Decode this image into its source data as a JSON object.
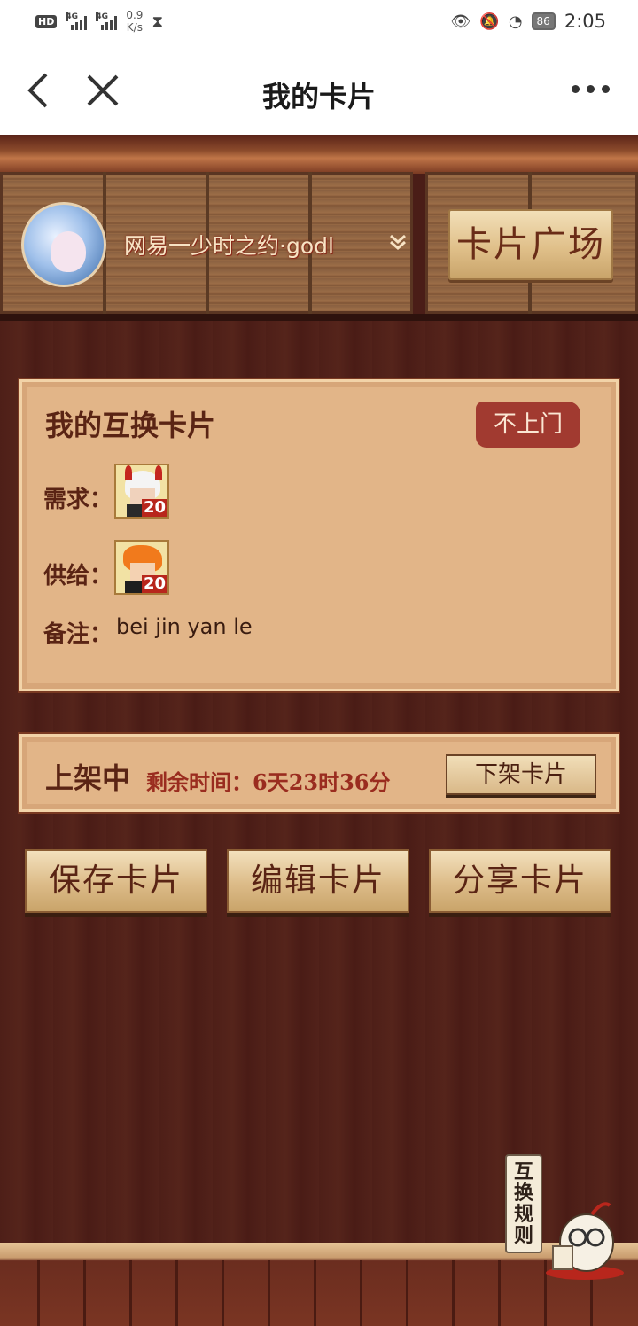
{
  "status_bar": {
    "hd": "HD",
    "signal1_label": "4G",
    "signal2_label": "4G",
    "speed_value": "0.9",
    "speed_unit": "K/s",
    "battery": "86",
    "time": "2:05"
  },
  "nav": {
    "title": "我的卡片"
  },
  "profile": {
    "username": "网易一少时之约·godl",
    "plaza_button": "卡片广场"
  },
  "exchange": {
    "title": "我的互换卡片",
    "stamp": "不上门",
    "need_label": "需求：",
    "need_card_level": "20",
    "supply_label": "供给：",
    "supply_card_level": "20",
    "note_label": "备注：",
    "note_text": "bei jin yan le"
  },
  "listing": {
    "status": "上架中",
    "remaining": "剩余时间：6天23时36分",
    "delist_button": "下架卡片"
  },
  "actions": {
    "save": "保存卡片",
    "edit": "编辑卡片",
    "share": "分享卡片"
  },
  "rules": {
    "label": "互换规则"
  }
}
